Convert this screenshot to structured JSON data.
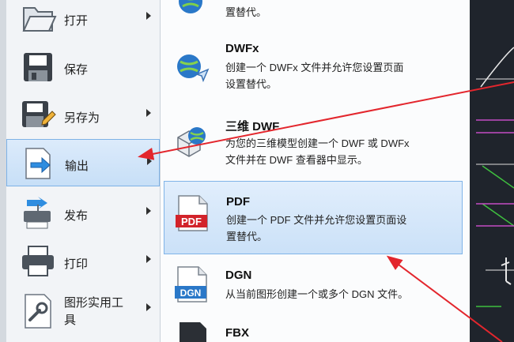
{
  "left_menu": {
    "items": [
      {
        "label": "打开",
        "icon": "open-folder-icon",
        "has_submenu": true
      },
      {
        "label": "保存",
        "icon": "save-disk-icon",
        "has_submenu": false
      },
      {
        "label": "另存为",
        "icon": "save-as-icon",
        "has_submenu": true
      },
      {
        "label": "输出",
        "icon": "export-icon",
        "has_submenu": true,
        "selected": true
      },
      {
        "label": "发布",
        "icon": "publish-icon",
        "has_submenu": true
      },
      {
        "label": "打印",
        "icon": "printer-icon",
        "has_submenu": true
      },
      {
        "label_line1": "图形实用工",
        "label_line2": "具",
        "icon": "drawing-utilities-icon",
        "has_submenu": true
      }
    ]
  },
  "submenu": {
    "top_partial_line": "置替代。",
    "items": [
      {
        "title": "DWFx",
        "desc_line1": "创建一个 DWFx 文件并允许您设置页面",
        "desc_line2": "设置替代。",
        "icon": "dwfx-globe-icon"
      },
      {
        "title": "三维 DWF",
        "desc_line1": "为您的三维模型创建一个 DWF 或 DWFx",
        "desc_line2": "文件并在 DWF 查看器中显示。",
        "icon": "3d-dwf-icon"
      },
      {
        "title": "PDF",
        "desc_line1": "创建一个 PDF 文件并允许您设置页面设",
        "desc_line2": "置替代。",
        "icon": "pdf-icon",
        "highlighted": true
      },
      {
        "title": "DGN",
        "desc_line1": "从当前图形创建一个或多个 DGN 文件。",
        "icon": "dgn-icon"
      },
      {
        "title": "FBX",
        "icon": "fbx-icon"
      }
    ],
    "pdf_icon_text": "PDF",
    "dgn_icon_text": "DGN"
  },
  "colors": {
    "selection_fill": "#cbe1f8",
    "selection_border": "#80b4e8",
    "annotation_arrow": "#e3262d",
    "cad_background": "#1f242c"
  }
}
